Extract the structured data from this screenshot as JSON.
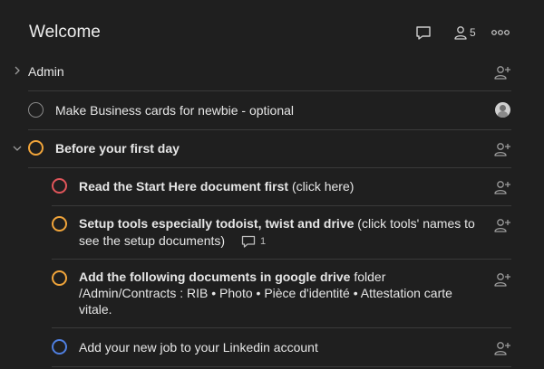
{
  "header": {
    "title": "Welcome",
    "member_count": "5"
  },
  "tasks": [
    {
      "label": "Admin"
    },
    {
      "label": "Make Business cards for newbie - optional"
    },
    {
      "label": "Before your first day"
    },
    {
      "label_bold": "Read the Start Here document first",
      "label_rest": " (click here)"
    },
    {
      "label_bold": "Setup tools especially todoist, twist and drive",
      "label_rest": " (click tools' names to see the setup documents)",
      "comment_count": "1"
    },
    {
      "label_bold": "Add the following documents in google drive",
      "label_rest": " folder /Admin/Contracts : RIB • Photo • Pièce d'identité • Attestation carte vitale."
    },
    {
      "label": "Add your new job to your Linkedin account"
    }
  ],
  "colors": {
    "background": "#1f1f1f",
    "priority_red": "#e0555a",
    "priority_orange": "#f0a43a",
    "priority_blue": "#4f7fe0",
    "neutral_circle": "#8a8a8a"
  }
}
